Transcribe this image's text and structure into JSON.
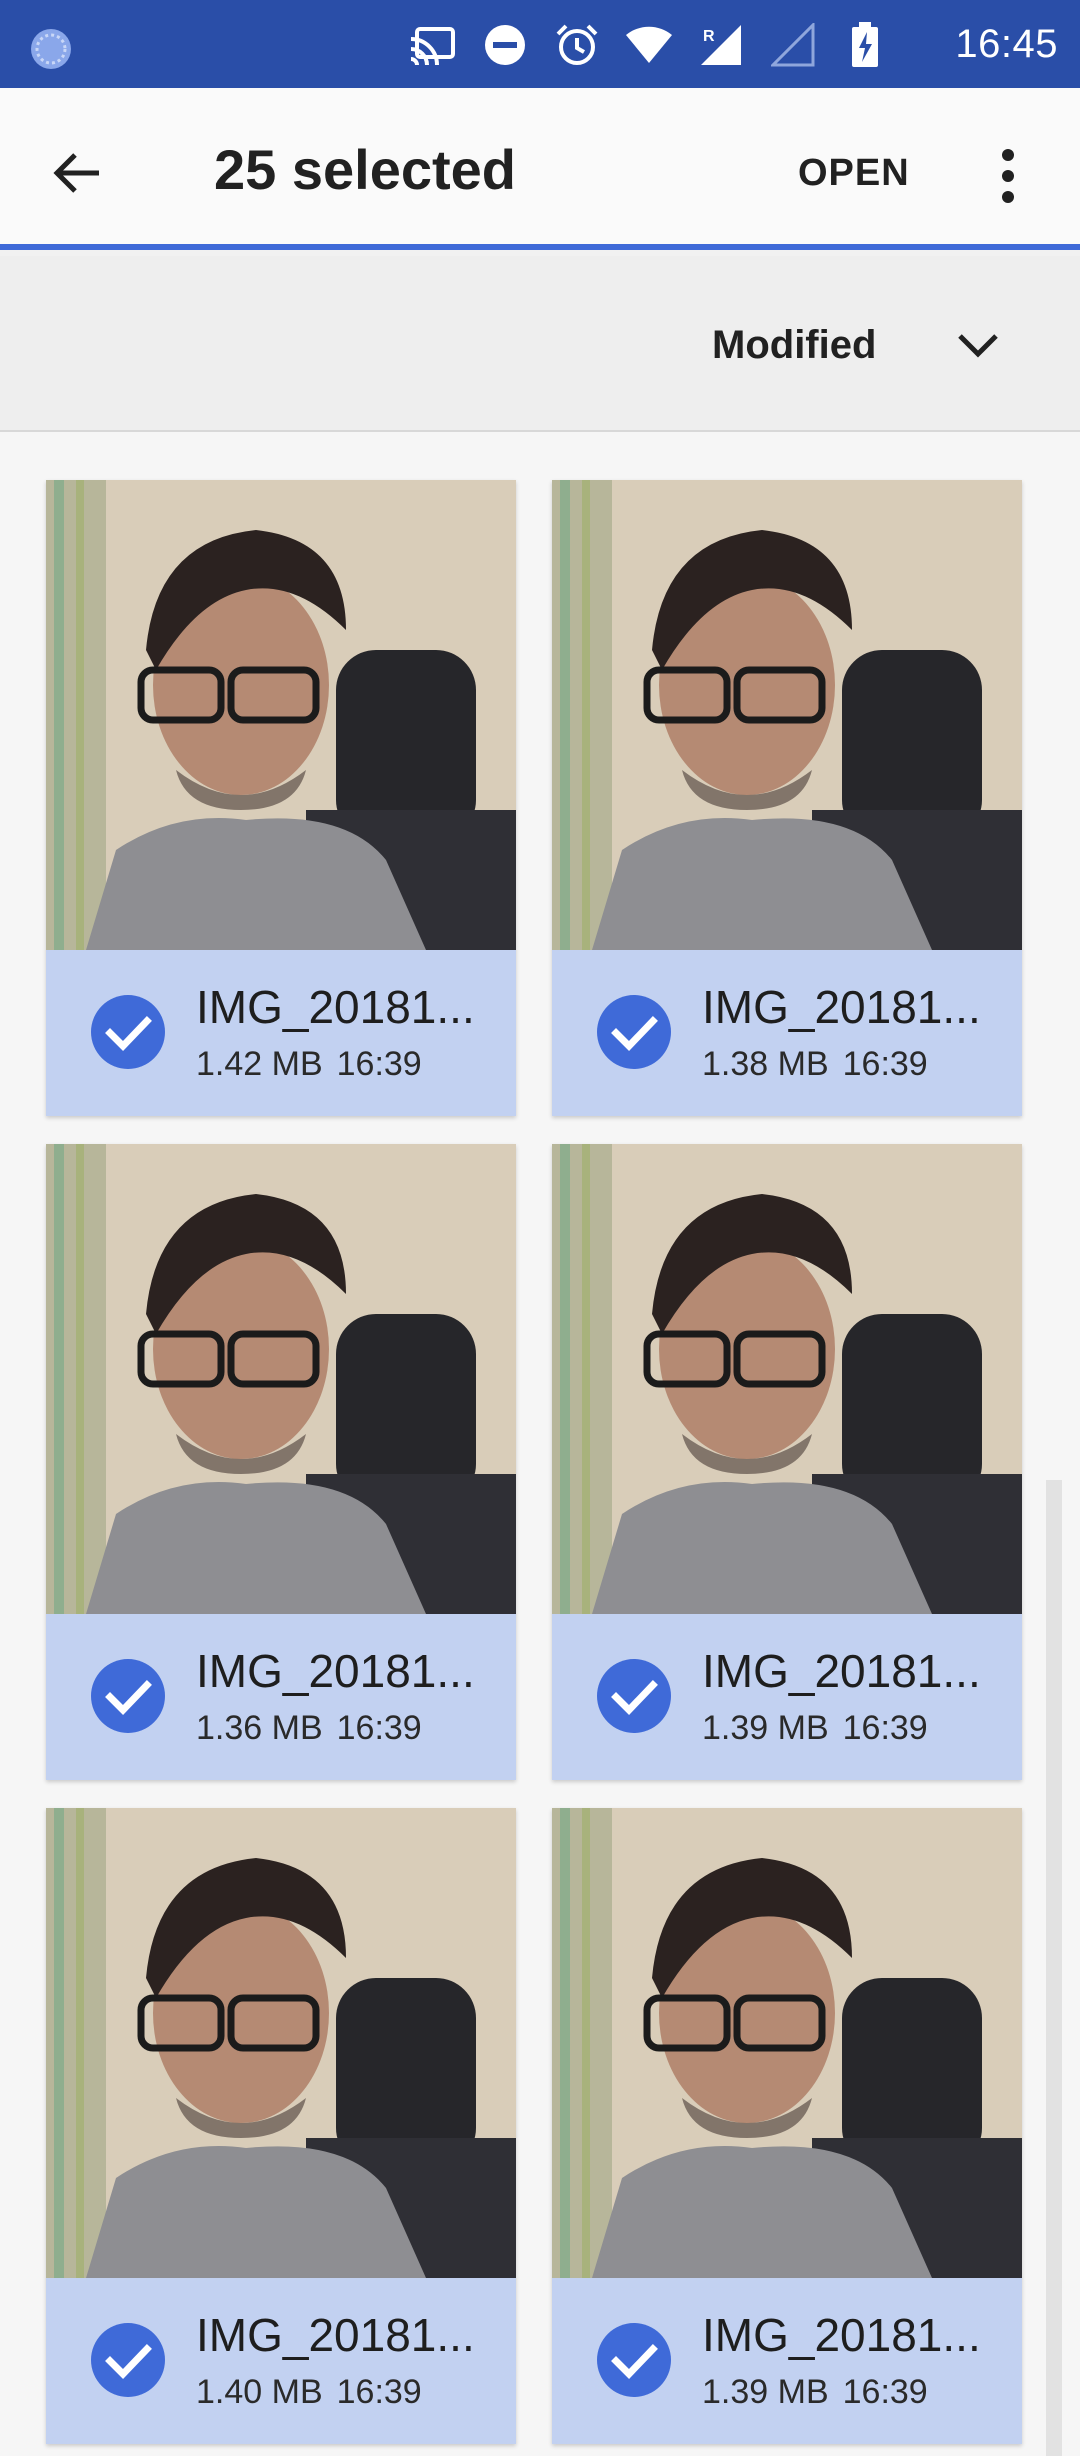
{
  "status_bar": {
    "time": "16:45",
    "icons": [
      "cast-icon",
      "dnd-icon",
      "alarm-icon",
      "wifi-icon",
      "signal-roaming-icon",
      "signal-empty-icon",
      "battery-charging-icon"
    ]
  },
  "app_bar": {
    "title": "25 selected",
    "open_label": "OPEN"
  },
  "sort_bar": {
    "label": "Modified"
  },
  "files": [
    {
      "name": "IMG_20181...",
      "size": "1.42 MB",
      "time": "16:39",
      "selected": true
    },
    {
      "name": "IMG_20181...",
      "size": "1.38 MB",
      "time": "16:39",
      "selected": true
    },
    {
      "name": "IMG_20181...",
      "size": "1.36 MB",
      "time": "16:39",
      "selected": true
    },
    {
      "name": "IMG_20181...",
      "size": "1.39 MB",
      "time": "16:39",
      "selected": true
    },
    {
      "name": "IMG_20181...",
      "size": "1.40 MB",
      "time": "16:39",
      "selected": true
    },
    {
      "name": "IMG_20181...",
      "size": "1.39 MB",
      "time": "16:39",
      "selected": true
    }
  ],
  "colors": {
    "status_bar": "#2a4ea8",
    "accent": "#3f6ad8",
    "selected_card": "#c2d1f1"
  }
}
